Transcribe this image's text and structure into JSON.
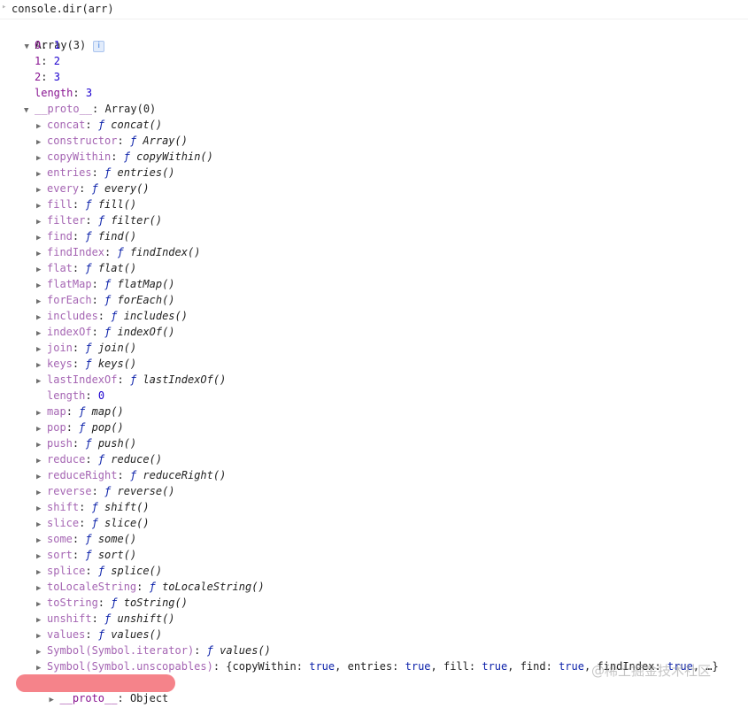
{
  "input": {
    "command": "console.dir(arr)"
  },
  "root": {
    "label": "Array(3)",
    "info_badge": "i"
  },
  "indices": [
    {
      "key": "0",
      "value": "1"
    },
    {
      "key": "1",
      "value": "2"
    },
    {
      "key": "2",
      "value": "3"
    }
  ],
  "length_row": {
    "key": "length",
    "value": "3"
  },
  "proto": {
    "key": "__proto__",
    "value": "Array(0)"
  },
  "methods_a": [
    {
      "key": "concat",
      "fn": "concat()"
    },
    {
      "key": "constructor",
      "fn": "Array()"
    },
    {
      "key": "copyWithin",
      "fn": "copyWithin()"
    },
    {
      "key": "entries",
      "fn": "entries()"
    },
    {
      "key": "every",
      "fn": "every()"
    },
    {
      "key": "fill",
      "fn": "fill()"
    },
    {
      "key": "filter",
      "fn": "filter()"
    },
    {
      "key": "find",
      "fn": "find()"
    },
    {
      "key": "findIndex",
      "fn": "findIndex()"
    },
    {
      "key": "flat",
      "fn": "flat()"
    },
    {
      "key": "flatMap",
      "fn": "flatMap()"
    },
    {
      "key": "forEach",
      "fn": "forEach()"
    },
    {
      "key": "includes",
      "fn": "includes()"
    },
    {
      "key": "indexOf",
      "fn": "indexOf()"
    },
    {
      "key": "join",
      "fn": "join()"
    },
    {
      "key": "keys",
      "fn": "keys()"
    },
    {
      "key": "lastIndexOf",
      "fn": "lastIndexOf()"
    }
  ],
  "proto_length": {
    "key": "length",
    "value": "0"
  },
  "methods_b": [
    {
      "key": "map",
      "fn": "map()"
    },
    {
      "key": "pop",
      "fn": "pop()"
    },
    {
      "key": "push",
      "fn": "push()"
    },
    {
      "key": "reduce",
      "fn": "reduce()"
    },
    {
      "key": "reduceRight",
      "fn": "reduceRight()"
    },
    {
      "key": "reverse",
      "fn": "reverse()"
    },
    {
      "key": "shift",
      "fn": "shift()"
    },
    {
      "key": "slice",
      "fn": "slice()"
    },
    {
      "key": "some",
      "fn": "some()"
    },
    {
      "key": "sort",
      "fn": "sort()"
    },
    {
      "key": "splice",
      "fn": "splice()"
    },
    {
      "key": "toLocaleString",
      "fn": "toLocaleString()"
    },
    {
      "key": "toString",
      "fn": "toString()"
    },
    {
      "key": "unshift",
      "fn": "unshift()"
    },
    {
      "key": "values",
      "fn": "values()"
    },
    {
      "key": "Symbol(Symbol.iterator)",
      "fn": "values()"
    }
  ],
  "unscopables": {
    "key": "Symbol(Symbol.unscopables)",
    "open": "{",
    "pairs": [
      {
        "k": "copyWithin",
        "v": "true"
      },
      {
        "k": "entries",
        "v": "true"
      },
      {
        "k": "fill",
        "v": "true"
      },
      {
        "k": "find",
        "v": "true"
      },
      {
        "k": "findIndex",
        "v": "true"
      }
    ],
    "tail": "…}"
  },
  "proto_object": {
    "key": "__proto__",
    "value": "Object"
  },
  "function_symbol": "ƒ",
  "watermark": "@稀土掘金技术社区",
  "colors": {
    "key_bright": "#881391",
    "key_dim": "#a565b3",
    "number": "#1c00cf",
    "highlight": "#f5838a"
  }
}
